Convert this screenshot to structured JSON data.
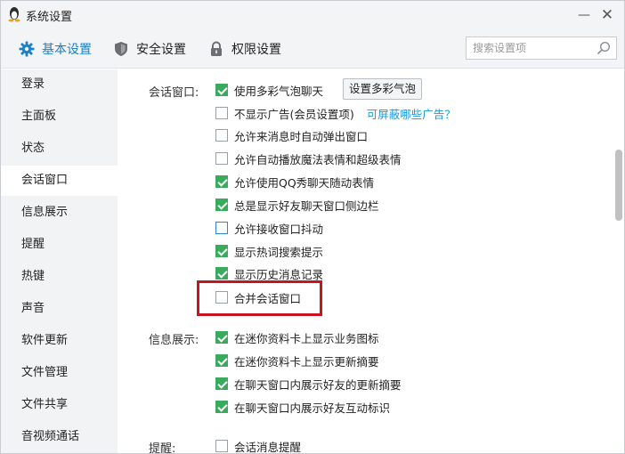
{
  "window": {
    "title": "系统设置",
    "minimize_label": "—",
    "close_label": "✕"
  },
  "tabs": [
    {
      "label": "基本设置",
      "icon": "gear-icon",
      "active": true
    },
    {
      "label": "安全设置",
      "icon": "shield-icon",
      "active": false
    },
    {
      "label": "权限设置",
      "icon": "lock-icon",
      "active": false
    }
  ],
  "search": {
    "placeholder": "搜索设置项",
    "value": ""
  },
  "sidebar": {
    "items": [
      {
        "label": "登录"
      },
      {
        "label": "主面板"
      },
      {
        "label": "状态"
      },
      {
        "label": "会话窗口",
        "active": true
      },
      {
        "label": "信息展示"
      },
      {
        "label": "提醒"
      },
      {
        "label": "热键"
      },
      {
        "label": "声音"
      },
      {
        "label": "软件更新"
      },
      {
        "label": "文件管理"
      },
      {
        "label": "文件共享"
      },
      {
        "label": "音视频通话"
      }
    ]
  },
  "sections": {
    "chat_window": {
      "label": "会话窗口:",
      "bubble_button": "设置多彩气泡",
      "ad_link": "可屏蔽哪些广告？",
      "options": [
        {
          "label": "使用多彩气泡聊天",
          "checked": true
        },
        {
          "label": "不显示广告(会员设置项)",
          "checked": false
        },
        {
          "label": "允许来消息时自动弹出窗口",
          "checked": false
        },
        {
          "label": "允许自动播放魔法表情和超级表情",
          "checked": false
        },
        {
          "label": "允许使用QQ秀聊天随动表情",
          "checked": true
        },
        {
          "label": "总是显示好友聊天窗口侧边栏",
          "checked": true
        },
        {
          "label": "允许接收窗口抖动",
          "checked": false
        },
        {
          "label": "显示热词搜索提示",
          "checked": true
        },
        {
          "label": "显示历史消息记录",
          "checked": true
        },
        {
          "label": "合并会话窗口",
          "checked": false
        }
      ]
    },
    "info_display": {
      "label": "信息展示:",
      "options": [
        {
          "label": "在迷你资料卡上显示业务图标",
          "checked": true
        },
        {
          "label": "在迷你资料卡上显示更新摘要",
          "checked": true
        },
        {
          "label": "在聊天窗口内展示好友的更新摘要",
          "checked": true
        },
        {
          "label": "在聊天窗口内展示好友互动标识",
          "checked": true
        }
      ]
    },
    "reminder": {
      "label": "提醒:",
      "options": [
        {
          "label": "会话消息提醒",
          "checked": false
        }
      ]
    }
  },
  "colors": {
    "accent_blue": "#1c7fc7",
    "check_green": "#3aab5c",
    "highlight_red": "#c8141e",
    "link_blue": "#1a9ad6"
  }
}
